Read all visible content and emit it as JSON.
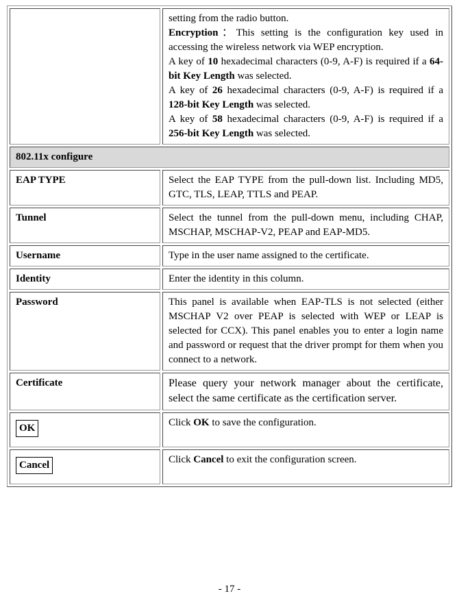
{
  "topRow": {
    "label": "",
    "desc_setting_from": "setting from the radio button.",
    "desc_encryption_label": "Encryption",
    "desc_encryption_punct": "：",
    "desc_encryption_text": "This setting is the configuration key used in accessing the wireless network via WEP encryption.",
    "desc_key10_pre": "A key of ",
    "desc_key10_bold": "10",
    "desc_key10_mid": " hexadecimal characters (0-9, A-F) is required if a ",
    "desc_key10_bold2": "64-bit Key Length",
    "desc_key10_end": " was selected.",
    "desc_key26_pre": "A key of ",
    "desc_key26_bold": "26",
    "desc_key26_mid": " hexadecimal characters (0-9, A-F) is required if a ",
    "desc_key26_bold2": "128-bit Key Length",
    "desc_key26_end": " was selected.",
    "desc_key58_pre": "A key of ",
    "desc_key58_bold": "58",
    "desc_key58_mid": " hexadecimal characters (0-9, A-F) is required if a ",
    "desc_key58_bold2": "256-bit Key Length",
    "desc_key58_end": " was selected."
  },
  "sectionHeader": "802.11x configure",
  "rows": {
    "eapType": {
      "label": "EAP TYPE",
      "desc": "Select the EAP TYPE from the pull-down list. Including MD5, GTC, TLS, LEAP, TTLS and PEAP."
    },
    "tunnel": {
      "label": "Tunnel",
      "desc": "Select the tunnel from the pull-down menu, including CHAP, MSCHAP, MSCHAP-V2, PEAP and EAP-MD5."
    },
    "username": {
      "label": "Username",
      "desc": "Type in the user name assigned to the certificate."
    },
    "identity": {
      "label": "Identity",
      "desc": "Enter the identity in this column."
    },
    "password": {
      "label": "Password",
      "desc": "This panel is available when EAP-TLS is not selected (either MSCHAP V2 over PEAP is selected with WEP or LEAP is selected for CCX). This panel enables you to enter a login name and password or request that the driver prompt for them when you connect to a network."
    },
    "certificate": {
      "label": "Certificate",
      "desc": "Please query your network manager about the certificate, select the same certificate as the certification server."
    },
    "ok": {
      "label": "OK",
      "desc_pre": "Click ",
      "desc_bold": "OK",
      "desc_post": " to save the configuration."
    },
    "cancel": {
      "label": "Cancel",
      "desc_pre": "Click ",
      "desc_bold": "Cancel",
      "desc_post": " to exit the configuration screen."
    }
  },
  "pageNumber": "- 17 -"
}
